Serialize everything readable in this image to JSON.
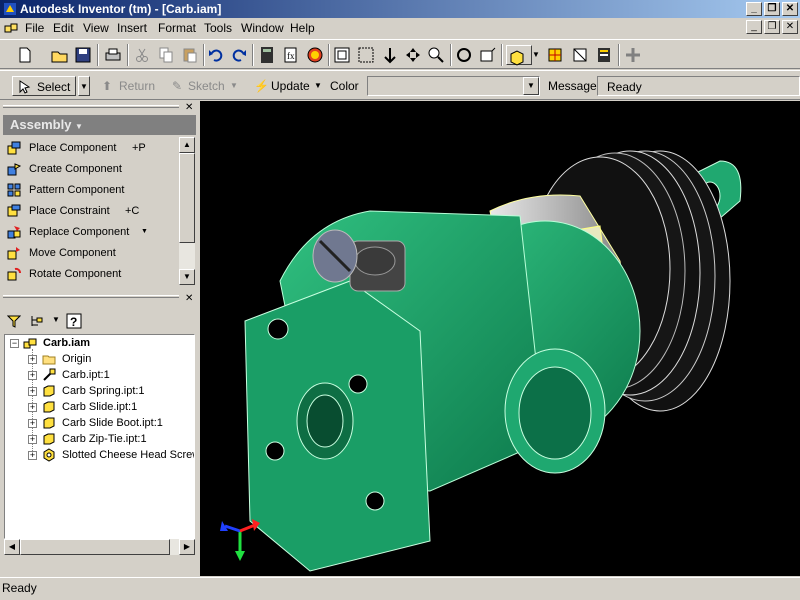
{
  "window": {
    "title": "Autodesk Inventor (tm) - [Carb.iam]"
  },
  "menu": [
    "File",
    "Edit",
    "View",
    "Insert",
    "Format",
    "Tools",
    "Window",
    "Help"
  ],
  "toolbar2": {
    "select_label": "Select",
    "return_label": "Return",
    "sketch_label": "Sketch",
    "update_label": "Update",
    "color_label": "Color",
    "color_value": "",
    "message_label": "Message",
    "message_value": "Ready"
  },
  "browser_panel": {
    "header": "Assembly",
    "commands": [
      {
        "label": "Place Component",
        "shortcut": "+P",
        "icon": "place-component-icon"
      },
      {
        "label": "Create Component",
        "shortcut": "",
        "icon": "create-component-icon"
      },
      {
        "label": "Pattern Component",
        "shortcut": "",
        "icon": "pattern-component-icon"
      },
      {
        "label": "Place Constraint",
        "shortcut": "+C",
        "icon": "place-constraint-icon"
      },
      {
        "label": "Replace Component",
        "shortcut": "",
        "icon": "replace-component-icon"
      },
      {
        "label": "Move Component",
        "shortcut": "",
        "icon": "move-component-icon"
      },
      {
        "label": "Rotate Component",
        "shortcut": "",
        "icon": "rotate-component-icon"
      }
    ]
  },
  "model_tree": {
    "root": "Carb.iam",
    "items": [
      {
        "label": "Origin",
        "icon": "folder-icon"
      },
      {
        "label": "Carb.ipt:1",
        "icon": "part-pin-icon"
      },
      {
        "label": "Carb Spring.ipt:1",
        "icon": "part-icon"
      },
      {
        "label": "Carb Slide.ipt:1",
        "icon": "part-icon"
      },
      {
        "label": "Carb Slide Boot.ipt:1",
        "icon": "part-icon"
      },
      {
        "label": "Carb Zip-Tie.ipt:1",
        "icon": "part-icon"
      },
      {
        "label": "Slotted Cheese Head Screw",
        "icon": "screw-icon"
      }
    ]
  },
  "status": {
    "text": "Ready"
  },
  "colors": {
    "model_green": "#1fa06a",
    "viewport_bg": "#000000",
    "title_bar": "#0a246a"
  }
}
